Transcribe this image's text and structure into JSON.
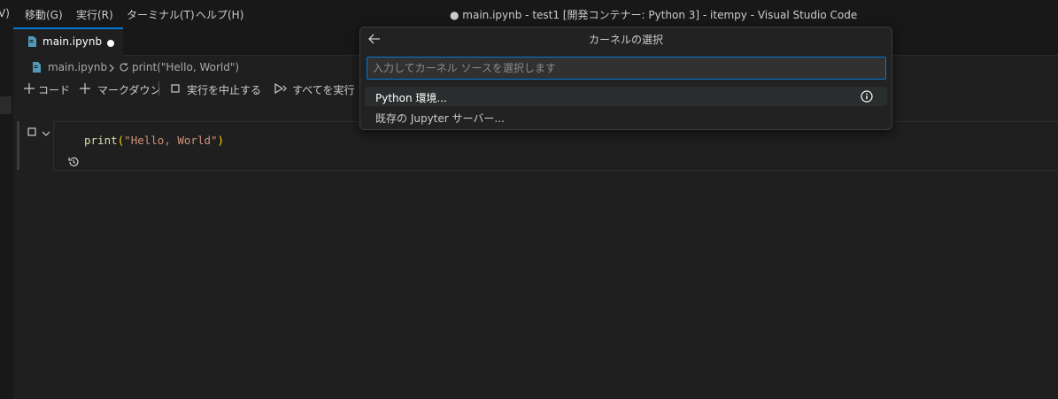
{
  "menu": {
    "items": [
      "V)",
      "移動(G)",
      "実行(R)",
      "ターミナル(T)",
      "ヘルプ(H)"
    ]
  },
  "window": {
    "title": "● main.ipynb - test1 [開発コンテナー: Python 3] - itempy - Visual Studio Code"
  },
  "tab": {
    "label": "main.ipynb"
  },
  "breadcrumb": {
    "file": "main.ipynb",
    "cell": "print(\"Hello, World\")"
  },
  "toolbar": {
    "code": "コード",
    "markdown": "マークダウン",
    "interrupt": "実行を中止する",
    "run_all": "すべてを実行"
  },
  "cell": {
    "fn": "print",
    "open": "(",
    "str": "\"Hello, World\"",
    "close": ")"
  },
  "quickpick": {
    "title": "カーネルの選択",
    "placeholder": "入力してカーネル ソースを選択します",
    "items": [
      {
        "label": "Python 環境..."
      },
      {
        "label": "既存の Jupyter サーバー..."
      }
    ]
  },
  "colors": {
    "accent": "#0078d4",
    "background": "#1f1f1f",
    "titlebar": "#181818"
  }
}
